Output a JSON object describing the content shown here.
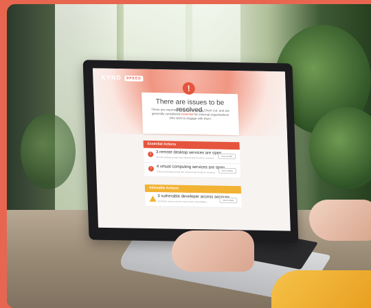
{
  "brand": {
    "logo": "KYND",
    "tag": "SPEED"
  },
  "headline": "There are issues to be resolved.",
  "subtext_parts": [
    "These are important risks for Example Client Ltd. and are generally considered ",
    "essential",
    " for external organisations who wish to engage with them."
  ],
  "sections": [
    {
      "title": "Essential Actions",
      "color": "#e5553d",
      "items": [
        {
          "title": "3 remote desktop services are open",
          "desc": "Remote desktop services are exposed and should be reviewed.",
          "button": "View Details"
        },
        {
          "title": "4 virtual computing services are open",
          "desc": "Virtual computing services are exposed and should be reviewed.",
          "button": "View Details"
        }
      ]
    },
    {
      "title": "Advisable Actions",
      "color": "#f2b233",
      "items": [
        {
          "title": "3 vulnerable developer access services",
          "desc": "Developer access services have known vulnerabilities.",
          "button": "View Details"
        }
      ]
    }
  ],
  "colors": {
    "accent": "#e5553d",
    "warning": "#f2b233",
    "background": "#e8664f"
  }
}
